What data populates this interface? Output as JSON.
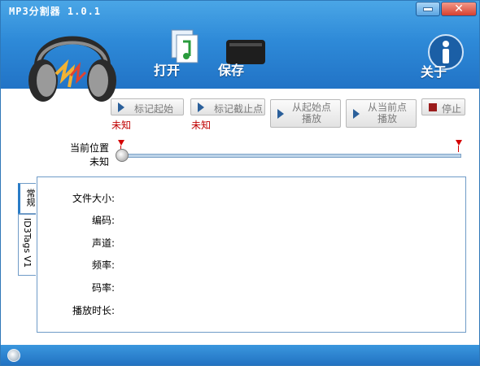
{
  "window": {
    "title": "MP3分割器 1.0.1"
  },
  "toolbar": {
    "open_label": "打开",
    "save_label": "保存",
    "about_label": "关于"
  },
  "controls": {
    "mark_start": "标记起始",
    "mark_end": "标记截止点",
    "play_from_start_line1": "从起始点",
    "play_from_start_line2": "播放",
    "play_from_current_line1": "从当前点",
    "play_from_current_line2": "播放",
    "stop": "停止",
    "start_value": "未知",
    "end_value": "未知"
  },
  "position": {
    "label": "当前位置",
    "value": "未知",
    "slider_fraction": 0.0
  },
  "tabs": [
    {
      "label": "常规",
      "active": true
    },
    {
      "label": "ID3Tags V1",
      "active": false
    }
  ],
  "fields": [
    {
      "label": "文件大小:"
    },
    {
      "label": "编码:"
    },
    {
      "label": "声道:"
    },
    {
      "label": "频率:"
    },
    {
      "label": "码率:"
    },
    {
      "label": "播放时长:"
    }
  ],
  "colors": {
    "title_blue": "#2e8ad8",
    "marker_red": "#d40000",
    "unknown_red": "#c00000"
  }
}
